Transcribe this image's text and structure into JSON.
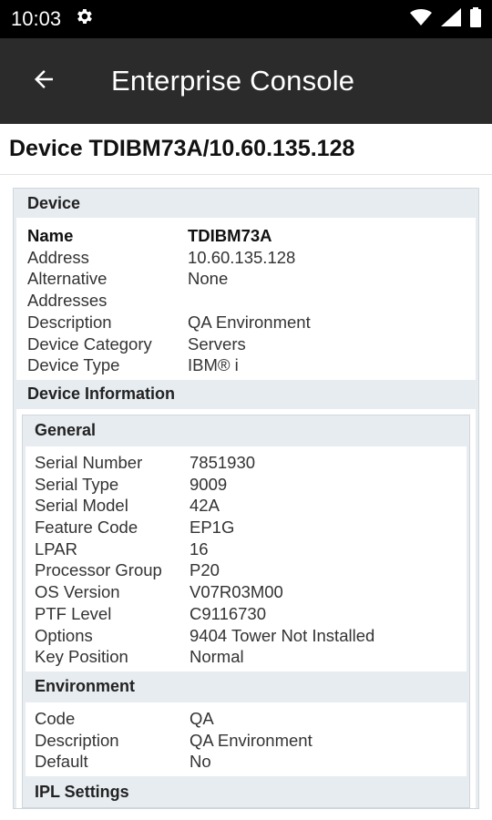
{
  "status_bar": {
    "time": "10:03"
  },
  "app_bar": {
    "title": "Enterprise Console"
  },
  "device_heading": "Device TDIBM73A/10.60.135.128",
  "device_panel": {
    "title": "Device",
    "rows": [
      {
        "label": "Name",
        "value": "TDIBM73A"
      },
      {
        "label": "Address",
        "value": "10.60.135.128"
      },
      {
        "label": "Alternative Addresses",
        "value": "None"
      },
      {
        "label": "Description",
        "value": "QA Environment"
      },
      {
        "label": "Device Category",
        "value": "Servers"
      },
      {
        "label": "Device Type",
        "value": "IBM® i"
      }
    ]
  },
  "device_info": {
    "title": "Device Information",
    "general": {
      "title": "General",
      "rows": [
        {
          "label": "Serial Number",
          "value": "7851930"
        },
        {
          "label": "Serial Type",
          "value": "9009"
        },
        {
          "label": "Serial Model",
          "value": "42A"
        },
        {
          "label": "Feature Code",
          "value": "EP1G"
        },
        {
          "label": "LPAR",
          "value": "16"
        },
        {
          "label": "Processor Group",
          "value": "P20"
        },
        {
          "label": "OS Version",
          "value": "V07R03M00"
        },
        {
          "label": "PTF Level",
          "value": "C9116730"
        },
        {
          "label": "Options",
          "value": "9404 Tower Not Installed"
        },
        {
          "label": "Key Position",
          "value": "Normal"
        }
      ]
    },
    "environment": {
      "title": "Environment",
      "rows": [
        {
          "label": "Code",
          "value": "QA"
        },
        {
          "label": "Description",
          "value": "QA Environment"
        },
        {
          "label": "Default",
          "value": "No"
        }
      ]
    },
    "ipl": {
      "title": "IPL Settings"
    }
  }
}
